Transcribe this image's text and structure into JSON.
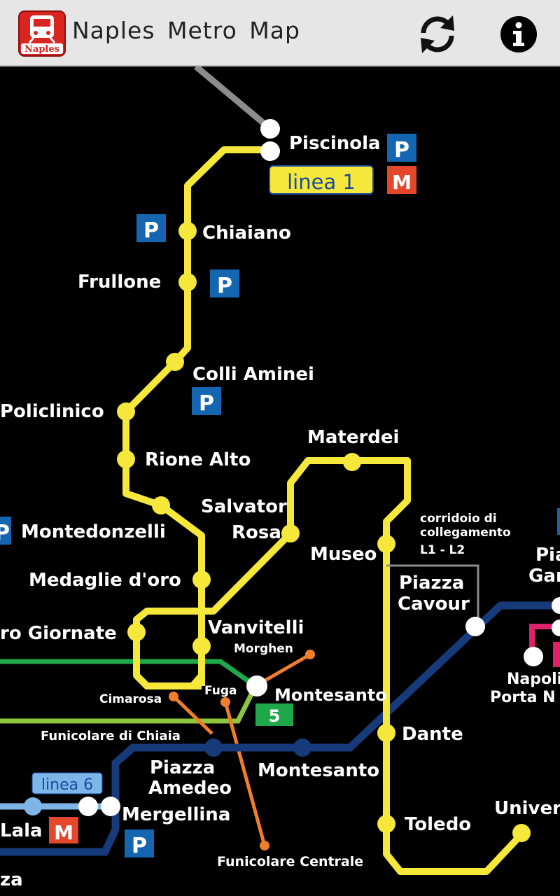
{
  "app": {
    "title": "Naples Metro Map",
    "icon_label": "Naples"
  },
  "toolbar": {
    "refresh_icon": "refresh-icon",
    "info_icon": "info-icon"
  },
  "colors": {
    "linea1": "#f6e83a",
    "linea6": "#7fb6e8",
    "linea2": "#163a7a",
    "funicular": "#f07e2a",
    "cumana": "#1fa84a",
    "circumflegrea": "#8fc63f",
    "parking": "#1466b0",
    "metro_logo": "#e4472a",
    "naples_red": "#d9241f"
  },
  "badges": {
    "linea1": "linea 1",
    "linea6": "linea 6",
    "line5": "5",
    "parking": "P",
    "metro": "M"
  },
  "stations": {
    "piscinola": "Piscinola",
    "chiaiano": "Chiaiano",
    "frullone": "Frullone",
    "colli_aminei": "Colli Aminei",
    "policlinico": "Policlinico",
    "rione_alto": "Rione Alto",
    "materdei": "Materdei",
    "salvator": "Salvator",
    "rosa": "Rosa",
    "montedonzelli": "Montedonzelli",
    "museo": "Museo",
    "medaglie": "Medaglie d'oro",
    "piazza": "Piazza",
    "cavour": "Cavour",
    "quattro_giornate": "ro Giornate",
    "vanvitelli": "Vanvitelli",
    "morghen": "Morghen",
    "fuga": "Fuga",
    "cimarosa": "Cimarosa",
    "montesanto_funi": "Montesanto",
    "funicolare_chiaia": "Funicolare di Chiaia",
    "dante": "Dante",
    "piazza_amedeo_1": "Piazza",
    "piazza_amedeo_2": "Amedeo",
    "montesanto_l2": "Montesanto",
    "mergellina": "Mergellina",
    "toledo": "Toledo",
    "lala": "Lala",
    "funicolare_centrale": "Funicolare Centrale",
    "univer": "Univer",
    "napoli_pn_1": "Napoli",
    "napoli_pn_2": "Porta N",
    "pia": "Pia",
    "gar": "Gar",
    "za": "za"
  },
  "notes": {
    "corridoio_1": "corridoio di",
    "corridoio_2": "collegamento",
    "corridoio_3": "L1 - L2"
  }
}
